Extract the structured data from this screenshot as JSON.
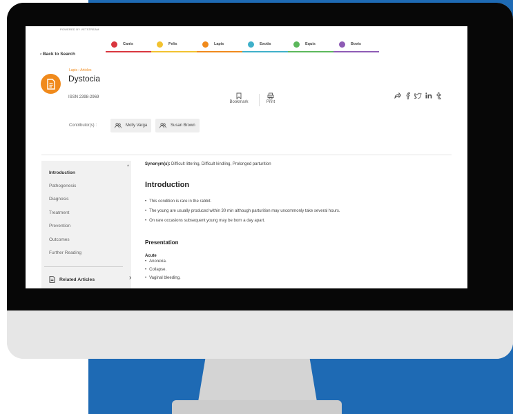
{
  "brand": {
    "powered_by": "POWERED BY VETSTREAM"
  },
  "species_tabs": [
    {
      "label": "Canis",
      "color": "#d9363e"
    },
    {
      "label": "Felis",
      "color": "#f2c230"
    },
    {
      "label": "Lapis",
      "color": "#f08a1c"
    },
    {
      "label": "Exotis",
      "color": "#3fb0c9"
    },
    {
      "label": "Equis",
      "color": "#5cb85c"
    },
    {
      "label": "Bovis",
      "color": "#8e5bb5"
    }
  ],
  "nav": {
    "back": "‹  Back to Search"
  },
  "article": {
    "breadcrumb": "Lapis › Articles",
    "title": "Dystocia",
    "issn": "ISSN 2398-2969",
    "actions": {
      "bookmark": "Bookmark",
      "print": "Print"
    },
    "contributors_label": "Contributor(s) :",
    "contributors": [
      "Molly Varga",
      "Susan Brown"
    ]
  },
  "sidebar": {
    "items": [
      "Introduction",
      "Pathogenesis",
      "Diagnosis",
      "Treatment",
      "Prevention",
      "Outcomes",
      "Further Reading"
    ],
    "related": "Related Articles"
  },
  "content": {
    "synonyms_label": "Synonym(s):",
    "synonyms": " Difficult littering, Difficult kindling, Prolonged parturition",
    "intro_heading": "Introduction",
    "intro_points": [
      "This condition is rare in the rabbit.",
      "The young are usually produced within 30 min although parturition may uncommonly take several hours.",
      "On rare occasions subsequent young may be born a day apart."
    ],
    "presentation_heading": "Presentation",
    "acute_heading": "Acute",
    "acute_points": [
      "Anorexia.",
      "Collapse.",
      "Vaginal bleeding."
    ]
  },
  "colors": {
    "accent": "#f08a1c",
    "background_blue": "#1e6ab4"
  }
}
